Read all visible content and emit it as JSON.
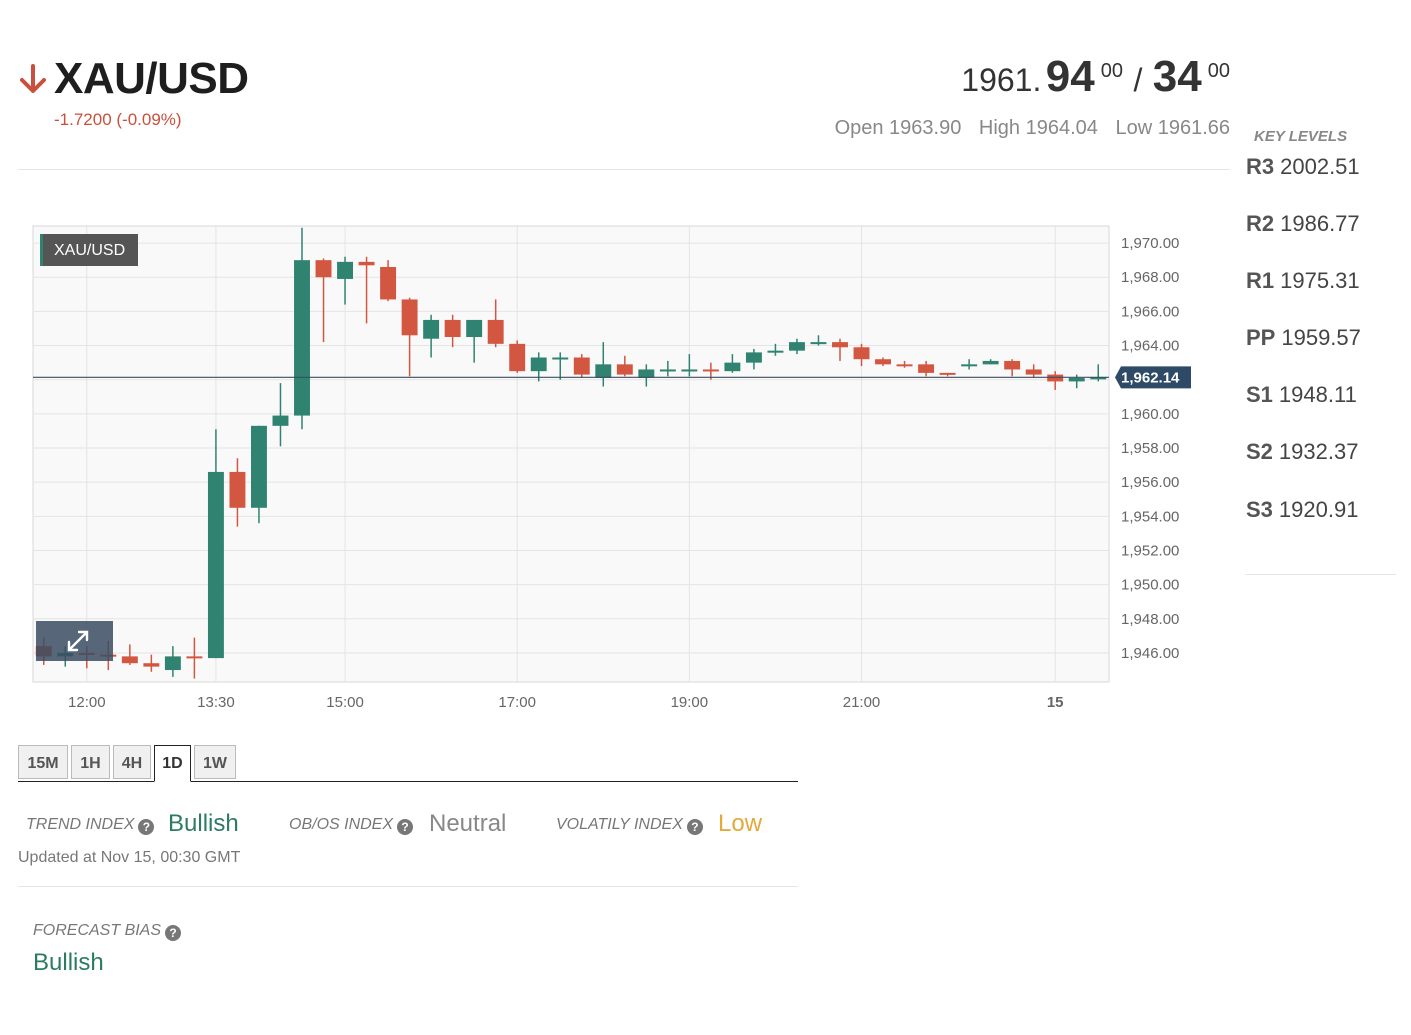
{
  "header": {
    "symbol": "XAU/USD",
    "direction_icon": "arrow-down-icon",
    "change": "-1.7200 (-0.09%)",
    "bid_main": "1961.",
    "bid_big": "94",
    "bid_sup": "00",
    "separator": "/",
    "ask_big": "34",
    "ask_sup": "00",
    "open": "Open 1963.90",
    "high": "High 1964.04",
    "low": "Low 1961.66"
  },
  "key_levels": {
    "title": "KEY LEVELS",
    "levels": [
      {
        "label": "R3",
        "value": "2002.51"
      },
      {
        "label": "R2",
        "value": "1986.77"
      },
      {
        "label": "R1",
        "value": "1975.31"
      },
      {
        "label": "PP",
        "value": "1959.57"
      },
      {
        "label": "S1",
        "value": "1948.11"
      },
      {
        "label": "S2",
        "value": "1932.37"
      },
      {
        "label": "S3",
        "value": "1920.91"
      }
    ]
  },
  "timeframes": [
    "15M",
    "1H",
    "4H",
    "1D",
    "1W"
  ],
  "active_timeframe": "1D",
  "indexes": {
    "trend": {
      "label": "TREND INDEX",
      "value": "Bullish",
      "color": "#2d7b63"
    },
    "obos": {
      "label": "OB/OS INDEX",
      "value": "Neutral",
      "color": "#888888"
    },
    "volatility": {
      "label": "VOLATILY INDEX",
      "value": "Low",
      "color": "#e3a93a"
    },
    "help_icon": "question-circle-icon"
  },
  "updated": "Updated at Nov 15, 00:30 GMT",
  "forecast": {
    "label": "FORECAST BIAS",
    "value": "Bullish"
  },
  "chart_data": {
    "type": "candlestick",
    "symbol_tag": "XAU/USD",
    "current_price_label": "1,962.14",
    "current_price": 1962.14,
    "ylim": [
      1944.3,
      1971.0
    ],
    "yticks": [
      "1,970.00",
      "1,968.00",
      "1,966.00",
      "1,964.00",
      "1,962.00",
      "1,960.00",
      "1,958.00",
      "1,956.00",
      "1,954.00",
      "1,952.00",
      "1,950.00",
      "1,948.00",
      "1,946.00"
    ],
    "ytick_values": [
      1970,
      1968,
      1966,
      1964,
      1962,
      1960,
      1958,
      1956,
      1954,
      1952,
      1950,
      1948,
      1946
    ],
    "xticks": [
      "12:00",
      "13:30",
      "15:00",
      "17:00",
      "19:00",
      "21:00",
      "15"
    ],
    "xtick_slots": [
      2,
      8,
      14,
      22,
      30,
      38,
      47
    ],
    "slot_count": 50,
    "colors": {
      "up": "#2f8370",
      "down": "#d35640",
      "price_line": "#3b4d63",
      "grid": "#e4e4e4"
    },
    "expand_icon": "expand-arrows-icon",
    "candles": [
      {
        "o": 1946.4,
        "h": 1946.9,
        "l": 1945.3,
        "c": 1945.8
      },
      {
        "o": 1945.8,
        "h": 1946.4,
        "l": 1945.2,
        "c": 1946.0
      },
      {
        "o": 1946.0,
        "h": 1946.4,
        "l": 1945.1,
        "c": 1945.9
      },
      {
        "o": 1945.9,
        "h": 1946.7,
        "l": 1945.0,
        "c": 1945.8
      },
      {
        "o": 1945.8,
        "h": 1946.5,
        "l": 1945.3,
        "c": 1945.4
      },
      {
        "o": 1945.4,
        "h": 1945.9,
        "l": 1944.9,
        "c": 1945.2
      },
      {
        "o": 1945.0,
        "h": 1946.4,
        "l": 1944.6,
        "c": 1945.8
      },
      {
        "o": 1945.8,
        "h": 1946.9,
        "l": 1944.5,
        "c": 1945.7
      },
      {
        "o": 1945.7,
        "h": 1959.1,
        "l": 1945.7,
        "c": 1956.6
      },
      {
        "o": 1956.6,
        "h": 1957.4,
        "l": 1953.4,
        "c": 1954.5
      },
      {
        "o": 1954.5,
        "h": 1959.3,
        "l": 1953.6,
        "c": 1959.3
      },
      {
        "o": 1959.3,
        "h": 1961.8,
        "l": 1958.1,
        "c": 1959.9
      },
      {
        "o": 1959.9,
        "h": 1970.9,
        "l": 1959.1,
        "c": 1969.0
      },
      {
        "o": 1969.0,
        "h": 1969.1,
        "l": 1964.2,
        "c": 1968.0
      },
      {
        "o": 1967.9,
        "h": 1969.2,
        "l": 1966.4,
        "c": 1968.9
      },
      {
        "o": 1968.9,
        "h": 1969.2,
        "l": 1965.3,
        "c": 1968.7
      },
      {
        "o": 1968.6,
        "h": 1969.0,
        "l": 1966.6,
        "c": 1966.7
      },
      {
        "o": 1966.7,
        "h": 1966.8,
        "l": 1962.2,
        "c": 1964.6
      },
      {
        "o": 1964.4,
        "h": 1965.8,
        "l": 1963.3,
        "c": 1965.5
      },
      {
        "o": 1965.5,
        "h": 1965.8,
        "l": 1963.9,
        "c": 1964.5
      },
      {
        "o": 1964.5,
        "h": 1965.5,
        "l": 1963.0,
        "c": 1965.5
      },
      {
        "o": 1965.5,
        "h": 1966.7,
        "l": 1963.9,
        "c": 1964.1
      },
      {
        "o": 1964.1,
        "h": 1964.3,
        "l": 1962.4,
        "c": 1962.5
      },
      {
        "o": 1962.5,
        "h": 1963.6,
        "l": 1961.9,
        "c": 1963.3
      },
      {
        "o": 1963.3,
        "h": 1963.6,
        "l": 1962.0,
        "c": 1963.3
      },
      {
        "o": 1963.3,
        "h": 1963.5,
        "l": 1962.1,
        "c": 1962.3
      },
      {
        "o": 1962.1,
        "h": 1964.2,
        "l": 1961.6,
        "c": 1962.9
      },
      {
        "o": 1962.9,
        "h": 1963.4,
        "l": 1962.2,
        "c": 1962.3
      },
      {
        "o": 1962.1,
        "h": 1962.9,
        "l": 1961.6,
        "c": 1962.6
      },
      {
        "o": 1962.6,
        "h": 1963.1,
        "l": 1962.2,
        "c": 1962.6
      },
      {
        "o": 1962.6,
        "h": 1963.5,
        "l": 1962.2,
        "c": 1962.6
      },
      {
        "o": 1962.6,
        "h": 1963.0,
        "l": 1962.0,
        "c": 1962.5
      },
      {
        "o": 1962.5,
        "h": 1963.5,
        "l": 1962.4,
        "c": 1963.0
      },
      {
        "o": 1963.0,
        "h": 1963.8,
        "l": 1962.6,
        "c": 1963.6
      },
      {
        "o": 1963.6,
        "h": 1964.1,
        "l": 1963.4,
        "c": 1963.7
      },
      {
        "o": 1963.7,
        "h": 1964.4,
        "l": 1963.5,
        "c": 1964.2
      },
      {
        "o": 1964.2,
        "h": 1964.6,
        "l": 1964.0,
        "c": 1964.2
      },
      {
        "o": 1964.2,
        "h": 1964.4,
        "l": 1963.1,
        "c": 1963.9
      },
      {
        "o": 1963.9,
        "h": 1964.1,
        "l": 1962.8,
        "c": 1963.2
      },
      {
        "o": 1963.2,
        "h": 1963.3,
        "l": 1962.8,
        "c": 1962.9
      },
      {
        "o": 1962.9,
        "h": 1963.1,
        "l": 1962.7,
        "c": 1962.8
      },
      {
        "o": 1962.9,
        "h": 1963.1,
        "l": 1962.2,
        "c": 1962.4
      },
      {
        "o": 1962.4,
        "h": 1962.4,
        "l": 1962.2,
        "c": 1962.3
      },
      {
        "o": 1962.9,
        "h": 1963.2,
        "l": 1962.6,
        "c": 1962.9
      },
      {
        "o": 1962.9,
        "h": 1963.2,
        "l": 1962.9,
        "c": 1963.1
      },
      {
        "o": 1963.1,
        "h": 1963.2,
        "l": 1962.2,
        "c": 1962.6
      },
      {
        "o": 1962.6,
        "h": 1962.9,
        "l": 1962.1,
        "c": 1962.3
      },
      {
        "o": 1962.3,
        "h": 1962.5,
        "l": 1961.4,
        "c": 1961.9
      },
      {
        "o": 1961.9,
        "h": 1962.3,
        "l": 1961.5,
        "c": 1962.1
      },
      {
        "o": 1962.1,
        "h": 1962.9,
        "l": 1961.9,
        "c": 1962.14
      }
    ]
  }
}
